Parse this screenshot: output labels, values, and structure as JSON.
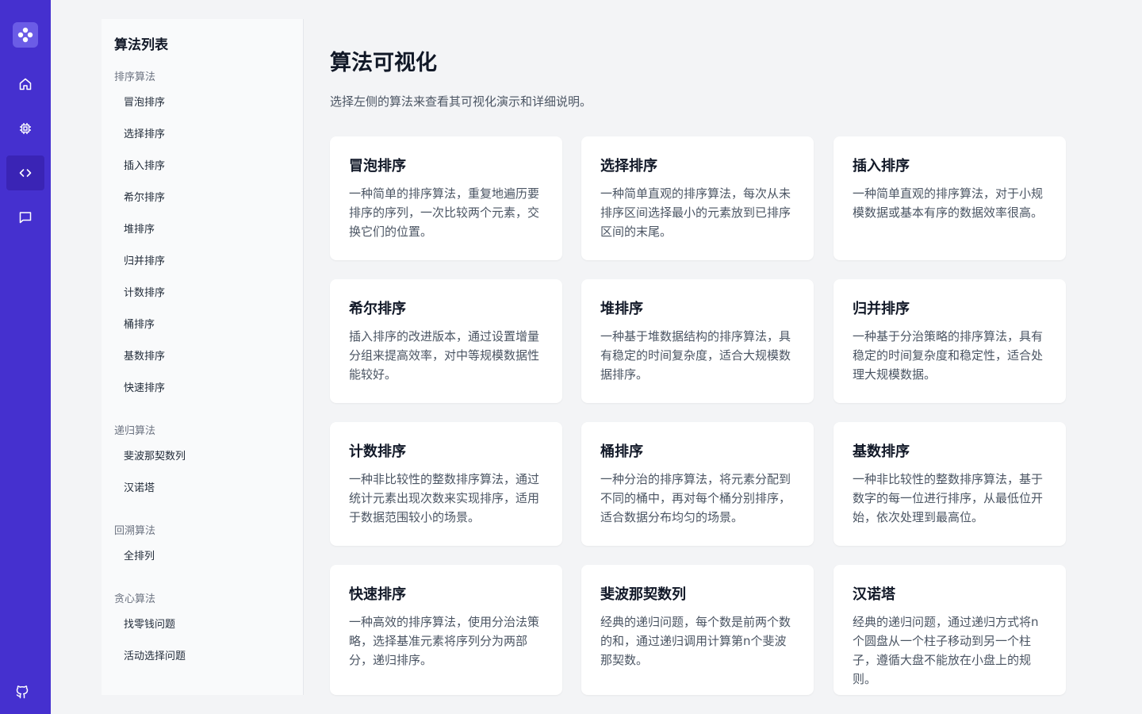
{
  "rail": {
    "logo_icon": "app-logo-icon",
    "items": [
      {
        "icon": "home-icon",
        "active": false
      },
      {
        "icon": "chip-icon",
        "active": false
      },
      {
        "icon": "code-icon",
        "active": true
      },
      {
        "icon": "chat-icon",
        "active": false
      }
    ],
    "footer_icon": "github-icon",
    "accent": "#4530cf"
  },
  "sidebar": {
    "title": "算法列表",
    "groups": [
      {
        "title": "排序算法",
        "items": [
          "冒泡排序",
          "选择排序",
          "插入排序",
          "希尔排序",
          "堆排序",
          "归并排序",
          "计数排序",
          "桶排序",
          "基数排序",
          "快速排序"
        ]
      },
      {
        "title": "递归算法",
        "items": [
          "斐波那契数列",
          "汉诺塔"
        ]
      },
      {
        "title": "回溯算法",
        "items": [
          "全排列"
        ]
      },
      {
        "title": "贪心算法",
        "items": [
          "找零钱问题",
          "活动选择问题"
        ]
      }
    ]
  },
  "main": {
    "title": "算法可视化",
    "description": "选择左侧的算法来查看其可视化演示和详细说明。",
    "cards": [
      {
        "title": "冒泡排序",
        "desc": "一种简单的排序算法，重复地遍历要排序的序列，一次比较两个元素，交换它们的位置。"
      },
      {
        "title": "选择排序",
        "desc": "一种简单直观的排序算法，每次从未排序区间选择最小的元素放到已排序区间的末尾。"
      },
      {
        "title": "插入排序",
        "desc": "一种简单直观的排序算法，对于小规模数据或基本有序的数据效率很高。"
      },
      {
        "title": "希尔排序",
        "desc": "插入排序的改进版本，通过设置增量分组来提高效率，对中等规模数据性能较好。"
      },
      {
        "title": "堆排序",
        "desc": "一种基于堆数据结构的排序算法，具有稳定的时间复杂度，适合大规模数据排序。"
      },
      {
        "title": "归并排序",
        "desc": "一种基于分治策略的排序算法，具有稳定的时间复杂度和稳定性，适合处理大规模数据。"
      },
      {
        "title": "计数排序",
        "desc": "一种非比较性的整数排序算法，通过统计元素出现次数来实现排序，适用于数据范围较小的场景。"
      },
      {
        "title": "桶排序",
        "desc": "一种分治的排序算法，将元素分配到不同的桶中，再对每个桶分别排序，适合数据分布均匀的场景。"
      },
      {
        "title": "基数排序",
        "desc": "一种非比较性的整数排序算法，基于数字的每一位进行排序，从最低位开始，依次处理到最高位。"
      },
      {
        "title": "快速排序",
        "desc": "一种高效的排序算法，使用分治法策略，选择基准元素将序列分为两部分，递归排序。"
      },
      {
        "title": "斐波那契数列",
        "desc": "经典的递归问题，每个数是前两个数的和，通过递归调用计算第n个斐波那契数。"
      },
      {
        "title": "汉诺塔",
        "desc": "经典的递归问题，通过递归方式将n个圆盘从一个柱子移动到另一个柱子，遵循大盘不能放在小盘上的规则。"
      }
    ]
  }
}
